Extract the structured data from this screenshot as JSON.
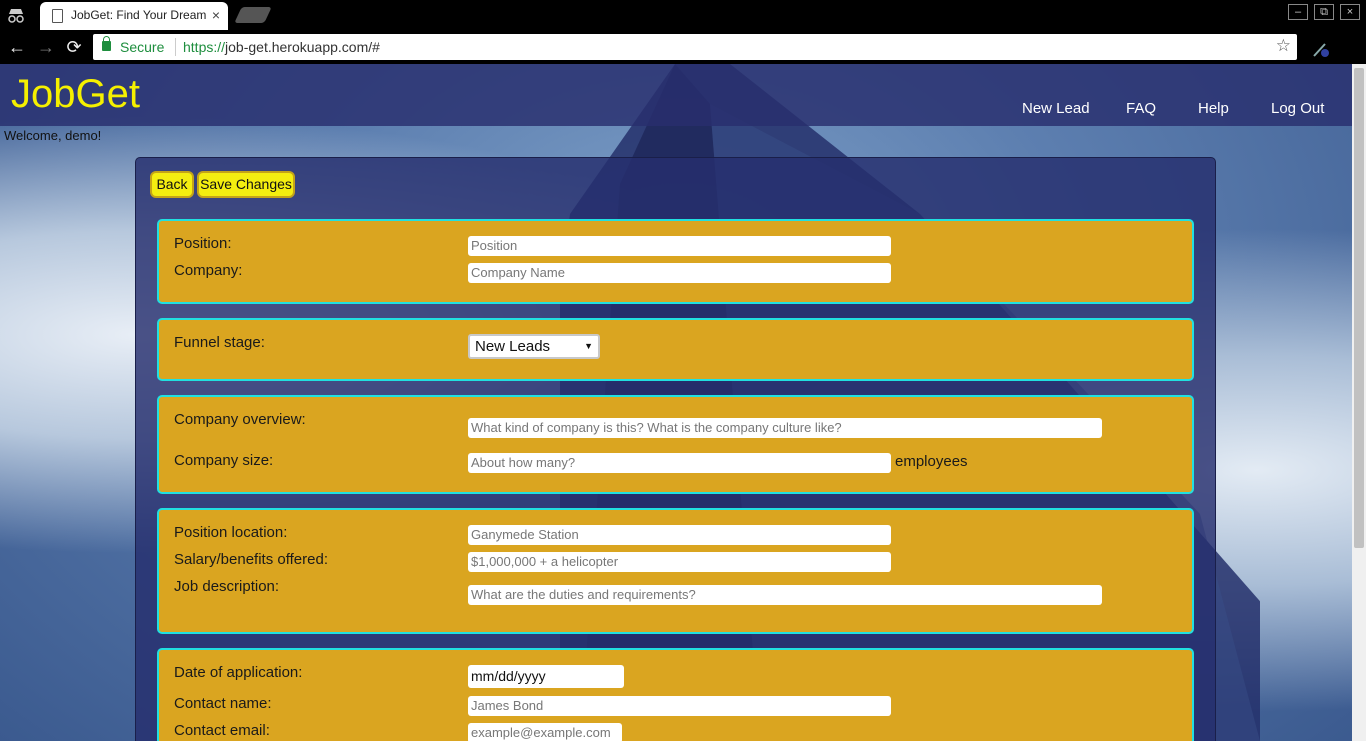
{
  "browser": {
    "tab_title": "JobGet: Find Your Dream",
    "tab_close": "×",
    "secure_label": "Secure",
    "url_scheme": "https://",
    "url_rest": "job-get.herokuapp.com/#",
    "back": "←",
    "forward": "→",
    "reload": "⟳",
    "star": "☆",
    "minimize": "–",
    "restore": "⧉",
    "close": "×"
  },
  "site": {
    "logo": "JobGet",
    "nav": [
      "New Lead",
      "FAQ",
      "Help",
      "Log Out"
    ],
    "welcome": "Welcome, demo!"
  },
  "actions": {
    "back_label": "Back",
    "save_label": "Save Changes"
  },
  "form": {
    "position_label": "Position:",
    "position_placeholder": "Position",
    "company_label": "Company:",
    "company_placeholder": "Company Name",
    "funnel_label": "Funnel stage:",
    "funnel_value": "New Leads",
    "overview_label": "Company overview:",
    "overview_placeholder": "What kind of company is this? What is the company culture like?",
    "size_label": "Company size:",
    "size_placeholder": "About how many?",
    "size_suffix": "employees",
    "location_label": "Position location:",
    "location_placeholder": "Ganymede Station",
    "salary_label": "Salary/benefits offered:",
    "salary_placeholder": "$1,000,000 + a helicopter",
    "jobdesc_label": "Job description:",
    "jobdesc_placeholder": "What are the duties and requirements?",
    "date_label": "Date of application:",
    "date_value": "mm/dd/yyyy",
    "contact_name_label": "Contact name:",
    "contact_name_placeholder": "James Bond",
    "contact_email_label": "Contact email:",
    "contact_email_placeholder": "example@example.com"
  },
  "colors": {
    "logo": "#f5f000",
    "card_bg": "#daa520",
    "card_border": "#21e0e0",
    "button_bg": "#f4ee10",
    "header_bg": "#282e6e"
  }
}
